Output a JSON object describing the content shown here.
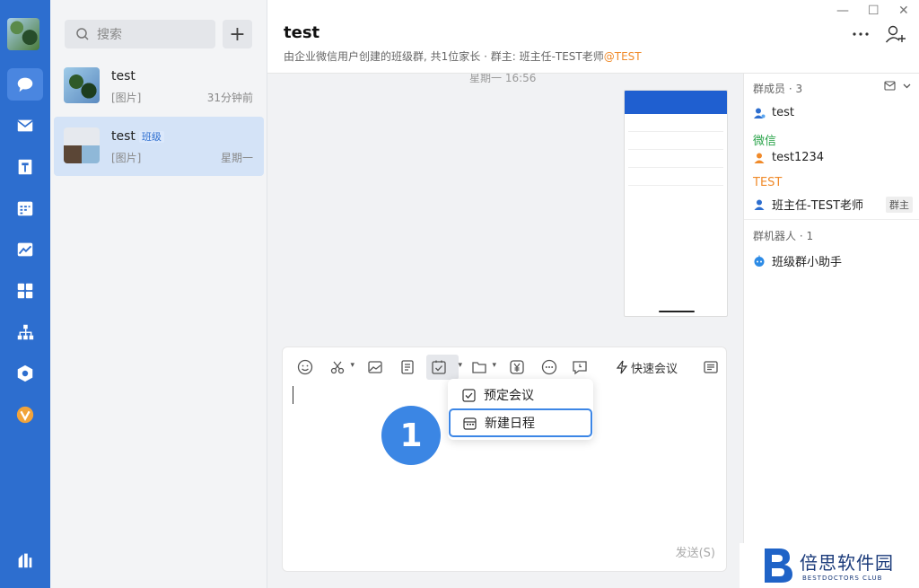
{
  "list": {
    "search_placeholder": "搜索",
    "add_label": "+",
    "conversations": [
      {
        "name": "test",
        "tag": "",
        "preview": "[图片]",
        "time": "31分钟前"
      },
      {
        "name": "test",
        "tag": "班级",
        "preview": "[图片]",
        "time": "星期一"
      }
    ]
  },
  "header": {
    "title": "test",
    "subtitle": "由企业微信用户创建的班级群, 共1位家长 · 群主: 班主任-TEST老师",
    "subtitle_tag": "@TEST"
  },
  "window": {
    "minimize": "—",
    "maximize": "☐",
    "close": "✕"
  },
  "chat": {
    "message_time": "星期一 16:56"
  },
  "compose": {
    "quick_meeting": "快速会议",
    "send_label": "发送(S)"
  },
  "menu": {
    "items": [
      "预定会议",
      "新建日程"
    ]
  },
  "step_badge": "1",
  "panel": {
    "members_title": "群成员 · 3",
    "members": [
      {
        "group": "",
        "name": "test"
      },
      {
        "group": "微信",
        "name": "test1234"
      },
      {
        "group": "TEST",
        "name": "班主任-TEST老师",
        "role": "群主"
      }
    ],
    "robots_title": "群机器人 · 1",
    "robot_name": "班级群小助手"
  },
  "watermark": {
    "cn": "倍思软件园",
    "en": "BESTDOCTORS CLUB"
  },
  "colors": {
    "rail": "#2d6ecf",
    "accent": "#3b86e4",
    "orange": "#f08a2a",
    "green": "#2aa34a"
  }
}
